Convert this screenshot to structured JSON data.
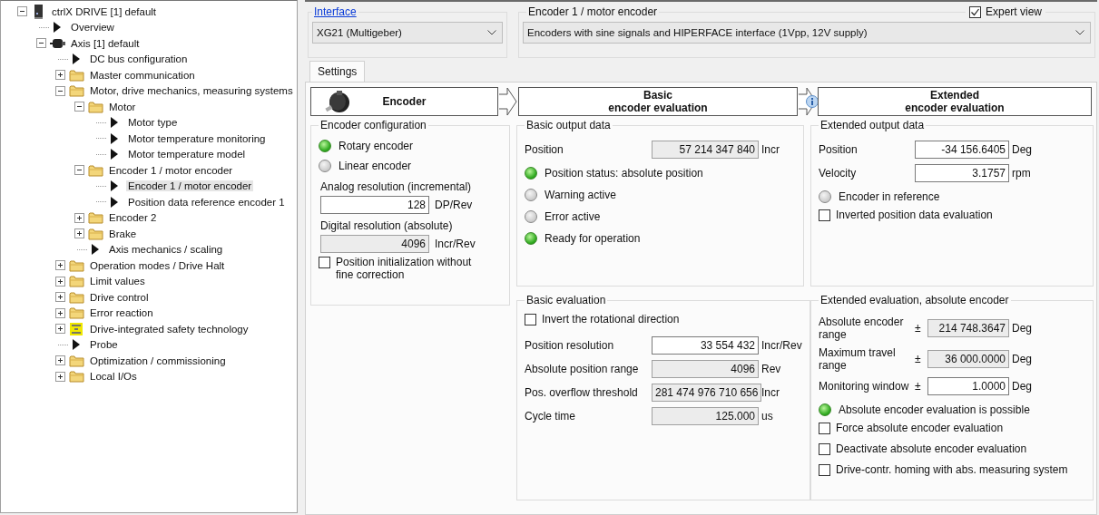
{
  "tree": [
    {
      "label": "ctrlX DRIVE [1] default",
      "kind": "device",
      "expanded": true,
      "selected": false,
      "children": [
        {
          "label": "Overview",
          "kind": "page",
          "selected": false
        },
        {
          "label": "Axis [1] default",
          "kind": "axis",
          "expanded": true,
          "selected": false,
          "children": [
            {
              "label": "DC bus configuration",
              "kind": "page",
              "selected": false
            },
            {
              "label": "Master communication",
              "kind": "folder",
              "expanded": false,
              "selected": false
            },
            {
              "label": "Motor, drive mechanics, measuring systems",
              "kind": "folder",
              "expanded": true,
              "selected": false,
              "children": [
                {
                  "label": "Motor",
                  "kind": "folder",
                  "expanded": true,
                  "selected": false,
                  "children": [
                    {
                      "label": "Motor type",
                      "kind": "page",
                      "selected": false
                    },
                    {
                      "label": "Motor temperature monitoring",
                      "kind": "page",
                      "selected": false
                    },
                    {
                      "label": "Motor temperature model",
                      "kind": "page",
                      "selected": false
                    }
                  ]
                },
                {
                  "label": "Encoder 1 / motor encoder",
                  "kind": "folder",
                  "expanded": true,
                  "selected": false,
                  "children": [
                    {
                      "label": "Encoder 1 / motor encoder",
                      "kind": "page",
                      "selected": true
                    },
                    {
                      "label": "Position data reference encoder 1",
                      "kind": "page",
                      "selected": false
                    }
                  ]
                },
                {
                  "label": "Encoder 2",
                  "kind": "folder",
                  "expanded": false,
                  "selected": false
                },
                {
                  "label": "Brake",
                  "kind": "folder",
                  "expanded": false,
                  "selected": false
                },
                {
                  "label": "Axis mechanics / scaling",
                  "kind": "page",
                  "selected": false
                }
              ]
            },
            {
              "label": "Operation modes / Drive Halt",
              "kind": "folder",
              "expanded": false,
              "selected": false
            },
            {
              "label": "Limit values",
              "kind": "folder",
              "expanded": false,
              "selected": false
            },
            {
              "label": "Drive control",
              "kind": "folder",
              "expanded": false,
              "selected": false
            },
            {
              "label": "Error reaction",
              "kind": "folder",
              "expanded": false,
              "selected": false
            },
            {
              "label": "Drive-integrated safety technology",
              "kind": "safety",
              "expanded": false,
              "selected": false
            },
            {
              "label": "Probe",
              "kind": "page",
              "selected": false
            },
            {
              "label": "Optimization / commissioning",
              "kind": "folder",
              "expanded": false,
              "selected": false
            },
            {
              "label": "Local I/Os",
              "kind": "folder",
              "expanded": false,
              "selected": false
            }
          ]
        }
      ]
    }
  ],
  "interface": {
    "label": "Interface",
    "value": "XG21 (Multigeber)"
  },
  "encoder_select": {
    "title": "Encoder 1 / motor encoder",
    "value": "Encoders with sine signals and HIPERFACE interface (1Vpp, 12V supply)",
    "expert_view": {
      "label": "Expert view",
      "checked": true
    }
  },
  "tabs": [
    {
      "label": "Settings",
      "selected": true
    }
  ],
  "stages": [
    {
      "kind": "encoder",
      "title_lines": [
        "Encoder"
      ],
      "info_before": false
    },
    {
      "kind": "plain",
      "title_lines": [
        "Basic",
        "encoder evaluation"
      ],
      "info_before": false
    },
    {
      "kind": "plain",
      "title_lines": [
        "Extended",
        "encoder evaluation"
      ],
      "info_before": true
    }
  ],
  "columns": [
    {
      "groups": [
        {
          "title": "Encoder configuration",
          "items": [
            {
              "kind": "lamp",
              "label": "Rotary encoder",
              "on": true
            },
            {
              "kind": "lamp",
              "label": "Linear encoder",
              "on": false
            },
            {
              "kind": "stacked_field",
              "label": "Analog resolution (incremental)",
              "value": "128",
              "unit": "DP/Rev",
              "readonly": false
            },
            {
              "kind": "stacked_field",
              "label": "Digital resolution (absolute)",
              "value": "4096",
              "unit": "Incr/Rev",
              "readonly": true
            },
            {
              "kind": "checkbox",
              "label": "Position initialization without fine correction",
              "checked": false
            }
          ]
        }
      ]
    },
    {
      "groups": [
        {
          "title": "Basic output data",
          "items": [
            {
              "kind": "field",
              "label": "Position",
              "value": "57 214 347 840",
              "unit": "Incr",
              "readonly": true
            },
            {
              "kind": "lamp",
              "label": "Position status: absolute position",
              "on": true
            },
            {
              "kind": "lamp",
              "label": "Warning active",
              "on": false
            },
            {
              "kind": "lamp",
              "label": "Error active",
              "on": false
            },
            {
              "kind": "lamp",
              "label": "Ready for operation",
              "on": true
            }
          ]
        },
        {
          "title": "Basic evaluation",
          "items": [
            {
              "kind": "checkbox",
              "label": "Invert the rotational direction",
              "checked": false
            },
            {
              "kind": "field",
              "label": "Position resolution",
              "value": "33 554 432",
              "unit": "Incr/Rev",
              "readonly": false
            },
            {
              "kind": "field",
              "label": "Absolute position range",
              "value": "4096",
              "unit": "Rev",
              "readonly": true
            },
            {
              "kind": "field",
              "label": "Pos. overflow threshold",
              "value": "281 474 976 710 656",
              "unit": "Incr",
              "readonly": true
            },
            {
              "kind": "field",
              "label": "Cycle time",
              "value": "125.000",
              "unit": "us",
              "readonly": true
            }
          ]
        }
      ]
    },
    {
      "groups": [
        {
          "title": "Extended output data",
          "items": [
            {
              "kind": "field",
              "label": "Position",
              "value": "-34 156.6405",
              "unit": "Deg",
              "readonly": false
            },
            {
              "kind": "field",
              "label": "Velocity",
              "value": "3.1757",
              "unit": "rpm",
              "readonly": false
            },
            {
              "kind": "lamp",
              "label": "Encoder in reference",
              "on": false
            },
            {
              "kind": "checkbox",
              "label": "Inverted position data evaluation",
              "checked": false
            }
          ]
        },
        {
          "title": "Extended evaluation, absolute encoder",
          "items": [
            {
              "kind": "field",
              "label": "Absolute encoder range",
              "prefix": "±",
              "value": "214 748.3647",
              "unit": "Deg",
              "readonly": true
            },
            {
              "kind": "field",
              "label": "Maximum travel range",
              "prefix": "±",
              "value": "36 000.0000",
              "unit": "Deg",
              "readonly": true
            },
            {
              "kind": "field",
              "label": "Monitoring window",
              "prefix": "±",
              "value": "1.0000",
              "unit": "Deg",
              "readonly": false
            },
            {
              "kind": "lamp",
              "label": "Absolute encoder evaluation is possible",
              "on": true
            },
            {
              "kind": "checkbox",
              "label": "Force absolute encoder evaluation",
              "checked": false
            },
            {
              "kind": "checkbox",
              "label": "Deactivate absolute encoder evaluation",
              "checked": false
            },
            {
              "kind": "checkbox",
              "label": "Drive-contr. homing with abs. measuring system",
              "checked": false
            }
          ]
        }
      ]
    }
  ]
}
